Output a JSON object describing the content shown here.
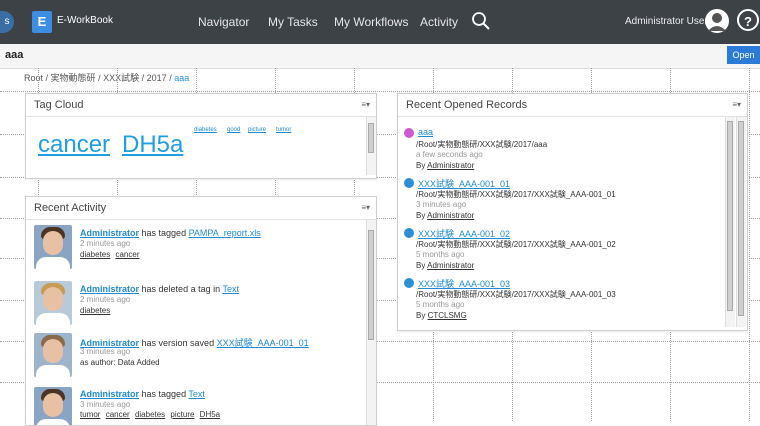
{
  "app": {
    "logo_letter": "E",
    "brand": "E-WorkBook",
    "edge_glyph": "s",
    "nav": [
      "Navigator",
      "My Tasks",
      "My Workflows",
      "Activity"
    ],
    "search_icon": "search-icon",
    "user": "Administrator User",
    "help_glyph": "?"
  },
  "titlebar": {
    "title": "aaa",
    "open_label": "Open"
  },
  "breadcrumb": {
    "parts": [
      "Root",
      "実物動態研",
      "XXX試験",
      "2017"
    ],
    "current": "aaa"
  },
  "tag_cloud": {
    "title": "Tag Cloud",
    "menu": "≡▾",
    "big": [
      "cancer",
      "DH5a"
    ],
    "small": [
      "diabetes",
      "good",
      "picture",
      "tumor"
    ]
  },
  "recent_activity": {
    "title": "Recent Activity",
    "menu": "≡▾",
    "items": [
      {
        "user": "Administrator",
        "verb": "has tagged",
        "target": "PAMPA_report.xls",
        "time": "2 minutes ago",
        "tags": [
          "diabetes",
          "cancer"
        ],
        "extra": ""
      },
      {
        "user": "Administrator",
        "verb": "has deleted a tag in",
        "target": "Text",
        "time": "2 minutes ago",
        "tags": [
          "diabetes"
        ],
        "extra": ""
      },
      {
        "user": "Administrator",
        "verb": "has version saved",
        "target": "XXX試験_AAA-001_01",
        "time": "3 minutes ago",
        "tags": [],
        "extra": "as author: Data Added"
      },
      {
        "user": "Administrator",
        "verb": "has tagged",
        "target": "Text",
        "time": "3 minutes ago",
        "tags": [
          "tumor",
          "cancer",
          "diabetes",
          "picture",
          "DH5a"
        ],
        "extra": ""
      }
    ]
  },
  "recent_records": {
    "title": "Recent Opened Records",
    "menu": "≡▾",
    "items": [
      {
        "name": "aaa",
        "path": "/Root/実物動態研/XXX試験/2017/aaa",
        "time": "a few seconds ago",
        "by_prefix": "By",
        "by": "Administrator",
        "icon_color": "#d05bd0"
      },
      {
        "name": "XXX試験_AAA-001_01",
        "path": "/Root/実物動態研/XXX試験/2017/XXX試験_AAA-001_01",
        "time": "3 minutes ago",
        "by_prefix": "By",
        "by": "Administrator",
        "icon_color": "#2a8fd4"
      },
      {
        "name": "XXX試験_AAA-001_02",
        "path": "/Root/実物動態研/XXX試験/2017/XXX試験_AAA-001_02",
        "time": "5 months ago",
        "by_prefix": "By",
        "by": "Administrator",
        "icon_color": "#2a8fd4"
      },
      {
        "name": "XXX試験_AAA-001_03",
        "path": "/Root/実物動態研/XXX試験/2017/XXX試験_AAA-001_03",
        "time": "5 months ago",
        "by_prefix": "By",
        "by": "CTCLSMG",
        "icon_color": "#2a8fd4"
      }
    ]
  },
  "colors": {
    "topbar": "#3d4247",
    "accent": "#1f8ad3",
    "open_button": "#2a7bd6"
  }
}
